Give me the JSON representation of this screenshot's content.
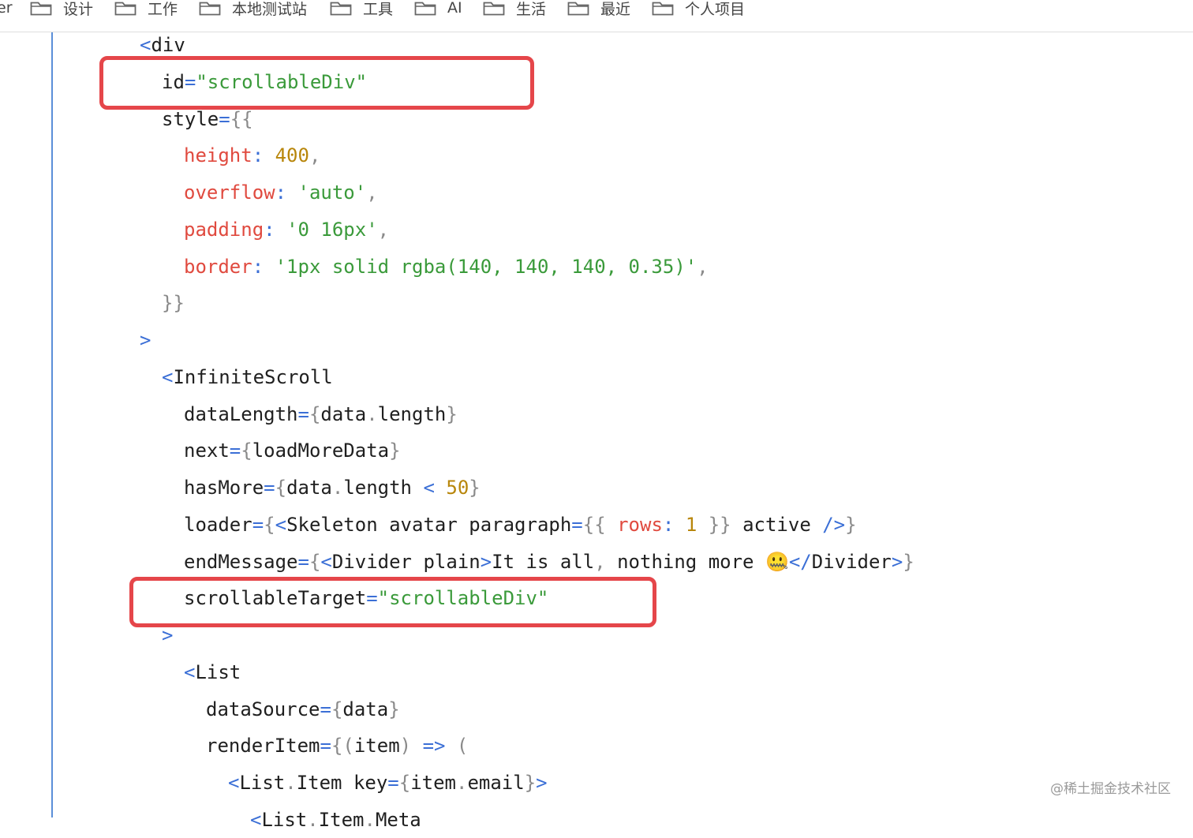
{
  "bookmarks": {
    "clipped": "er",
    "items": [
      {
        "label": "设计"
      },
      {
        "label": "工作"
      },
      {
        "label": "本地测试站"
      },
      {
        "label": "工具"
      },
      {
        "label": "AI"
      },
      {
        "label": "生活"
      },
      {
        "label": "最近"
      },
      {
        "label": "个人项目"
      }
    ]
  },
  "code_lines": [
    {
      "indent": 0,
      "tokens": [
        {
          "t": "<",
          "c": "tag"
        },
        {
          "t": "div",
          "c": "txt"
        }
      ]
    },
    {
      "indent": 1,
      "tokens": [
        {
          "t": "id",
          "c": "txt"
        },
        {
          "t": "=",
          "c": "op"
        },
        {
          "t": "\"scrollableDiv\"",
          "c": "str"
        }
      ]
    },
    {
      "indent": 1,
      "tokens": [
        {
          "t": "style",
          "c": "txt"
        },
        {
          "t": "=",
          "c": "op"
        },
        {
          "t": "{{",
          "c": "brace"
        }
      ]
    },
    {
      "indent": 2,
      "tokens": [
        {
          "t": "height",
          "c": "prop"
        },
        {
          "t": ": ",
          "c": "op"
        },
        {
          "t": "400",
          "c": "num"
        },
        {
          "t": ",",
          "c": "brace"
        }
      ]
    },
    {
      "indent": 2,
      "tokens": [
        {
          "t": "overflow",
          "c": "prop"
        },
        {
          "t": ": ",
          "c": "op"
        },
        {
          "t": "'auto'",
          "c": "str"
        },
        {
          "t": ",",
          "c": "brace"
        }
      ]
    },
    {
      "indent": 2,
      "tokens": [
        {
          "t": "padding",
          "c": "prop"
        },
        {
          "t": ": ",
          "c": "op"
        },
        {
          "t": "'0 16px'",
          "c": "str"
        },
        {
          "t": ",",
          "c": "brace"
        }
      ]
    },
    {
      "indent": 2,
      "tokens": [
        {
          "t": "border",
          "c": "prop"
        },
        {
          "t": ": ",
          "c": "op"
        },
        {
          "t": "'1px solid rgba(140, 140, 140, 0.35)'",
          "c": "str"
        },
        {
          "t": ",",
          "c": "brace"
        }
      ]
    },
    {
      "indent": 1,
      "tokens": [
        {
          "t": "}}",
          "c": "brace"
        }
      ]
    },
    {
      "indent": 0,
      "tokens": [
        {
          "t": ">",
          "c": "tag"
        }
      ]
    },
    {
      "indent": 1,
      "tokens": [
        {
          "t": "<",
          "c": "tag"
        },
        {
          "t": "InfiniteScroll",
          "c": "txt"
        }
      ]
    },
    {
      "indent": 2,
      "tokens": [
        {
          "t": "dataLength",
          "c": "txt"
        },
        {
          "t": "=",
          "c": "op"
        },
        {
          "t": "{",
          "c": "brace"
        },
        {
          "t": "data",
          "c": "txt"
        },
        {
          "t": ".",
          "c": "brace"
        },
        {
          "t": "length",
          "c": "txt"
        },
        {
          "t": "}",
          "c": "brace"
        }
      ]
    },
    {
      "indent": 2,
      "tokens": [
        {
          "t": "next",
          "c": "txt"
        },
        {
          "t": "=",
          "c": "op"
        },
        {
          "t": "{",
          "c": "brace"
        },
        {
          "t": "loadMoreData",
          "c": "txt"
        },
        {
          "t": "}",
          "c": "brace"
        }
      ]
    },
    {
      "indent": 2,
      "tokens": [
        {
          "t": "hasMore",
          "c": "txt"
        },
        {
          "t": "=",
          "c": "op"
        },
        {
          "t": "{",
          "c": "brace"
        },
        {
          "t": "data",
          "c": "txt"
        },
        {
          "t": ".",
          "c": "brace"
        },
        {
          "t": "length ",
          "c": "txt"
        },
        {
          "t": "<",
          "c": "op"
        },
        {
          "t": " ",
          "c": "txt"
        },
        {
          "t": "50",
          "c": "num"
        },
        {
          "t": "}",
          "c": "brace"
        }
      ]
    },
    {
      "indent": 2,
      "tokens": [
        {
          "t": "loader",
          "c": "txt"
        },
        {
          "t": "=",
          "c": "op"
        },
        {
          "t": "{",
          "c": "brace"
        },
        {
          "t": "<",
          "c": "tag"
        },
        {
          "t": "Skeleton avatar paragraph",
          "c": "txt"
        },
        {
          "t": "=",
          "c": "op"
        },
        {
          "t": "{{ ",
          "c": "brace"
        },
        {
          "t": "rows",
          "c": "prop"
        },
        {
          "t": ": ",
          "c": "op"
        },
        {
          "t": "1",
          "c": "num"
        },
        {
          "t": " }}",
          "c": "brace"
        },
        {
          "t": " active ",
          "c": "txt"
        },
        {
          "t": "/>",
          "c": "tag"
        },
        {
          "t": "}",
          "c": "brace"
        }
      ]
    },
    {
      "indent": 2,
      "tokens": [
        {
          "t": "endMessage",
          "c": "txt"
        },
        {
          "t": "=",
          "c": "op"
        },
        {
          "t": "{",
          "c": "brace"
        },
        {
          "t": "<",
          "c": "tag"
        },
        {
          "t": "Divider plain",
          "c": "txt"
        },
        {
          "t": ">",
          "c": "tag"
        },
        {
          "t": "It is all",
          "c": "txt"
        },
        {
          "t": ",",
          "c": "brace"
        },
        {
          "t": " nothing more 🤐",
          "c": "txt"
        },
        {
          "t": "</",
          "c": "tag"
        },
        {
          "t": "Divider",
          "c": "txt"
        },
        {
          "t": ">",
          "c": "tag"
        },
        {
          "t": "}",
          "c": "brace"
        }
      ]
    },
    {
      "indent": 2,
      "tokens": [
        {
          "t": "scrollableTarget",
          "c": "txt"
        },
        {
          "t": "=",
          "c": "op"
        },
        {
          "t": "\"scrollableDiv\"",
          "c": "str"
        }
      ]
    },
    {
      "indent": 1,
      "tokens": [
        {
          "t": ">",
          "c": "tag"
        }
      ]
    },
    {
      "indent": 2,
      "tokens": [
        {
          "t": "<",
          "c": "tag"
        },
        {
          "t": "List",
          "c": "txt"
        }
      ]
    },
    {
      "indent": 3,
      "tokens": [
        {
          "t": "dataSource",
          "c": "txt"
        },
        {
          "t": "=",
          "c": "op"
        },
        {
          "t": "{",
          "c": "brace"
        },
        {
          "t": "data",
          "c": "txt"
        },
        {
          "t": "}",
          "c": "brace"
        }
      ]
    },
    {
      "indent": 3,
      "tokens": [
        {
          "t": "renderItem",
          "c": "txt"
        },
        {
          "t": "=",
          "c": "op"
        },
        {
          "t": "{",
          "c": "brace"
        },
        {
          "t": "(",
          "c": "brace"
        },
        {
          "t": "item",
          "c": "txt"
        },
        {
          "t": ")",
          "c": "brace"
        },
        {
          "t": " ",
          "c": "txt"
        },
        {
          "t": "=>",
          "c": "op"
        },
        {
          "t": " ",
          "c": "txt"
        },
        {
          "t": "(",
          "c": "brace"
        }
      ]
    },
    {
      "indent": 4,
      "tokens": [
        {
          "t": "<",
          "c": "tag"
        },
        {
          "t": "List",
          "c": "txt"
        },
        {
          "t": ".",
          "c": "brace"
        },
        {
          "t": "Item key",
          "c": "txt"
        },
        {
          "t": "=",
          "c": "op"
        },
        {
          "t": "{",
          "c": "brace"
        },
        {
          "t": "item",
          "c": "txt"
        },
        {
          "t": ".",
          "c": "brace"
        },
        {
          "t": "email",
          "c": "txt"
        },
        {
          "t": "}",
          "c": "brace"
        },
        {
          "t": ">",
          "c": "tag"
        }
      ]
    },
    {
      "indent": 5,
      "tokens": [
        {
          "t": "<",
          "c": "tag"
        },
        {
          "t": "List",
          "c": "txt"
        },
        {
          "t": ".",
          "c": "brace"
        },
        {
          "t": "Item",
          "c": "txt"
        },
        {
          "t": ".",
          "c": "brace"
        },
        {
          "t": "Meta",
          "c": "txt"
        }
      ]
    }
  ],
  "watermark": "@稀土掘金技术社区"
}
